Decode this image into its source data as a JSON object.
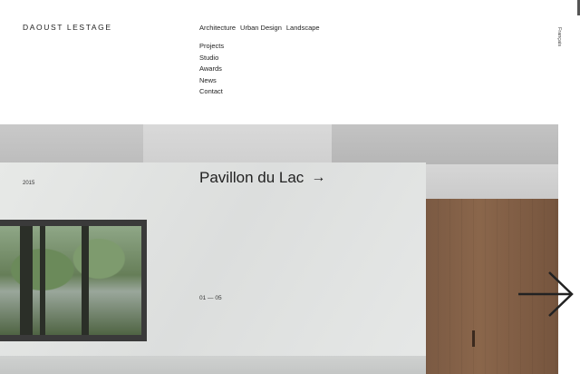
{
  "header": {
    "logo": "DAOUST LESTAGE",
    "disciplines": [
      "Architecture",
      "Urban Design",
      "Landscape"
    ],
    "menu": [
      "Projects",
      "Studio",
      "Awards",
      "News",
      "Contact"
    ],
    "language": "Français"
  },
  "project": {
    "year": "2015",
    "title": "Pavillon du Lac",
    "arrow": "→",
    "counter": "01 — 05"
  }
}
